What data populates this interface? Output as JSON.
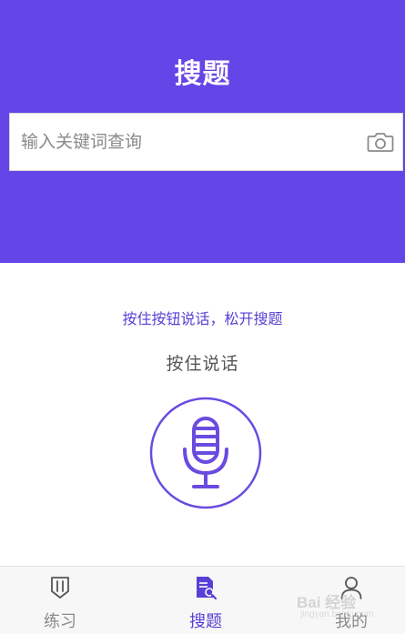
{
  "header": {
    "title": "搜题",
    "background_color": "#6445E7"
  },
  "search": {
    "placeholder": "输入关键词查询",
    "value": "",
    "camera_icon": "camera-icon"
  },
  "voice": {
    "hint": "按住按钮说话，松开搜题",
    "label": "按住说话",
    "mic_icon": "microphone-icon",
    "accent_color": "#5A3FD6"
  },
  "tabbar": {
    "tabs": [
      {
        "label": "练习",
        "icon": "practice-icon",
        "active": false
      },
      {
        "label": "搜题",
        "icon": "search-document-icon",
        "active": true
      },
      {
        "label": "我的",
        "icon": "user-icon",
        "active": false
      }
    ]
  },
  "watermark": {
    "text": "Bai 经验",
    "subtext": "jingyan.baidu.com"
  }
}
